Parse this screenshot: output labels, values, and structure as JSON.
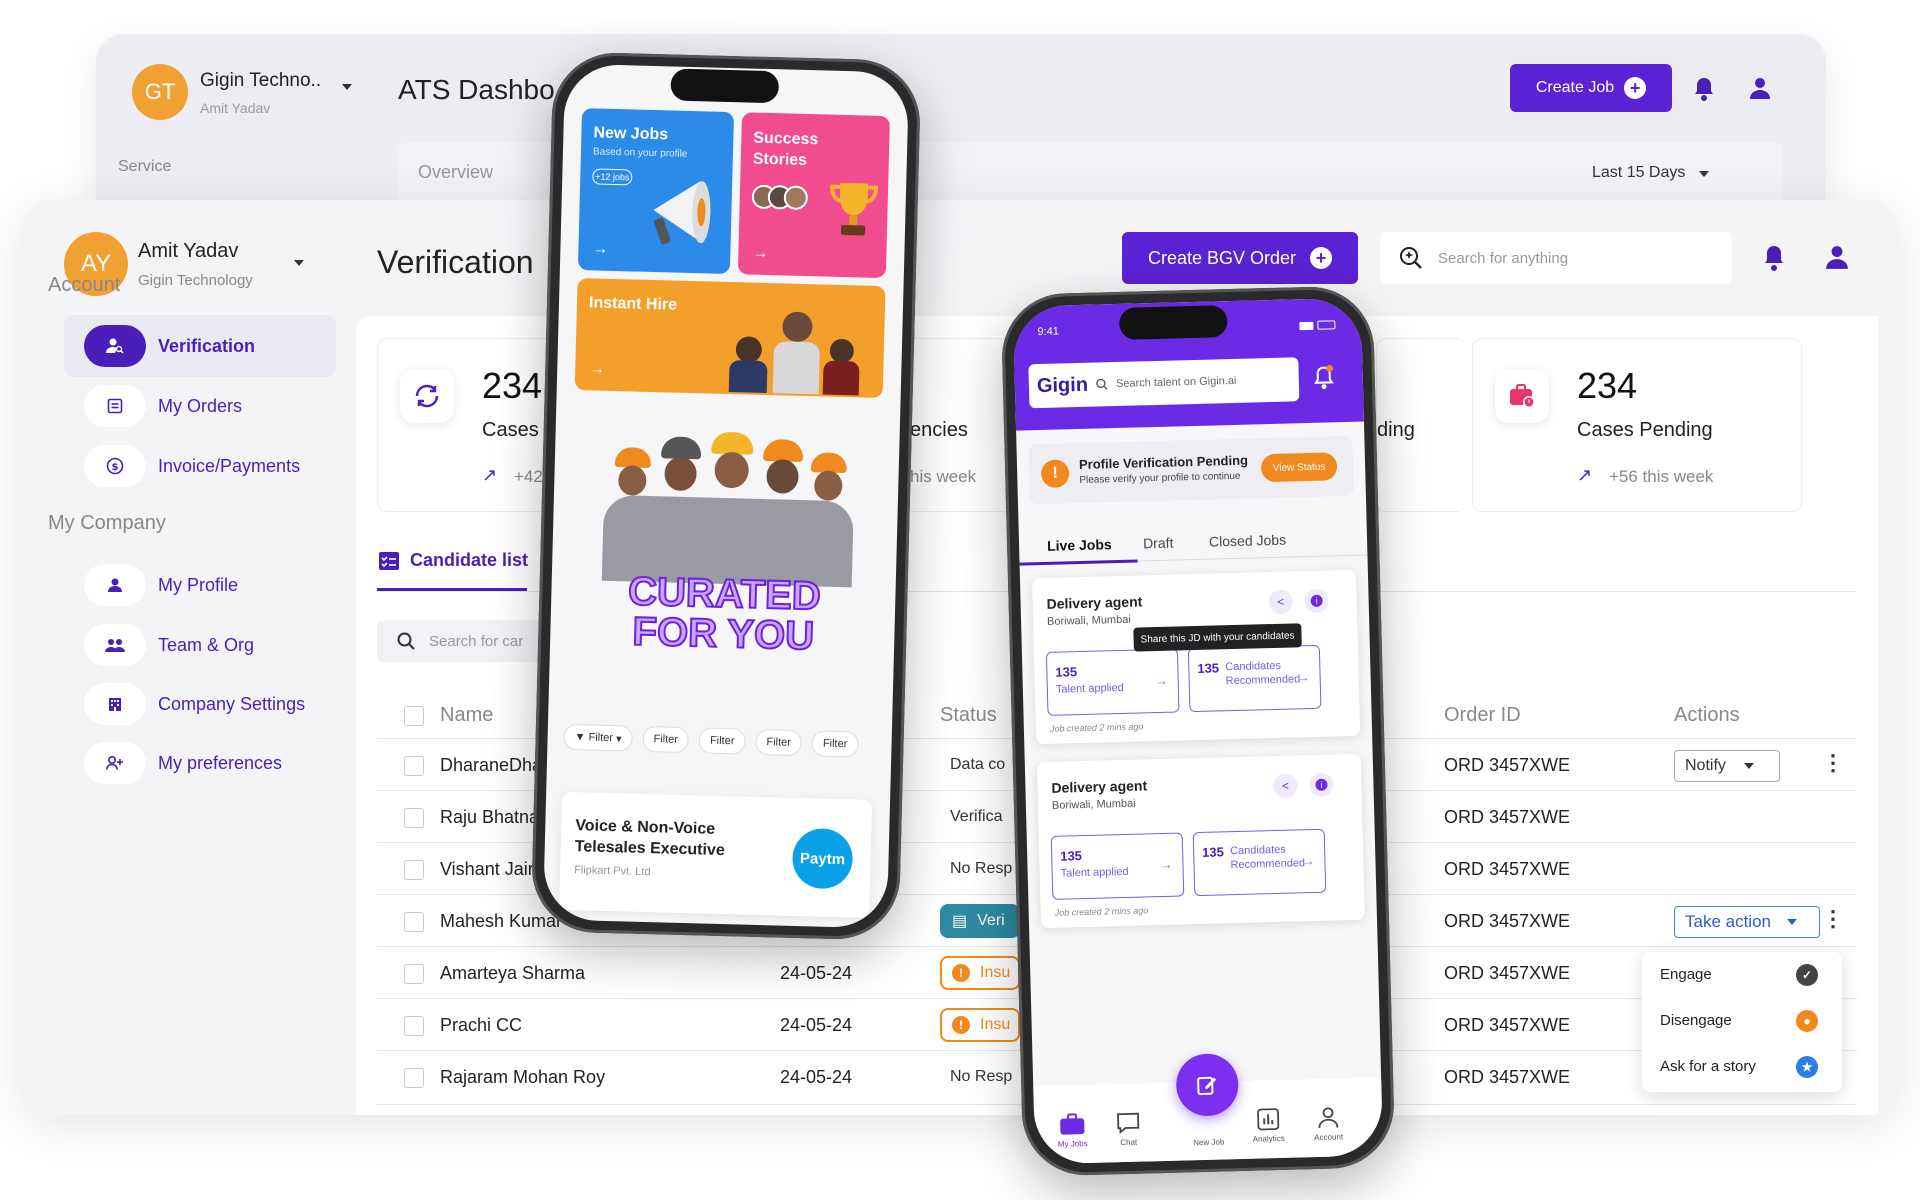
{
  "colors": {
    "primary": "#5a22d4",
    "brand_dark": "#4a1fb8",
    "warning": "#f08a1f",
    "teal": "#2d8aa1",
    "avatar": "#f1a132"
  },
  "back_window": {
    "avatar_initials": "GT",
    "org_name": "Gigin Techno..",
    "user_name": "Amit Yadav",
    "title": "ATS Dashbo",
    "sidebar_label": "Service",
    "tab_overview": "Overview",
    "date_range": "Last 15 Days",
    "create_job": "Create Job"
  },
  "main_window": {
    "avatar_initials": "AY",
    "user_name": "Amit Yadav",
    "org_name": "Gigin Technology",
    "title": "Verification",
    "create_bgv": "Create BGV Order",
    "search_placeholder": "Search for anything",
    "sidebar": {
      "account_heading": "Account",
      "account_items": [
        {
          "label": "Verification",
          "icon": "user-search-icon",
          "active": true
        },
        {
          "label": "My Orders",
          "icon": "orders-icon"
        },
        {
          "label": "Invoice/Payments",
          "icon": "dollar-icon"
        }
      ],
      "company_heading": "My Company",
      "company_items": [
        {
          "label": "My Profile",
          "icon": "person-icon"
        },
        {
          "label": "Team & Org",
          "icon": "team-icon"
        },
        {
          "label": "Company Settings",
          "icon": "building-icon"
        },
        {
          "label": "My preferences",
          "icon": "add-user-icon"
        }
      ]
    },
    "stats": [
      {
        "value": "234",
        "label": "Cases",
        "week": "+42"
      },
      {
        "label": "encies",
        "week": "his week"
      },
      {
        "label": "ding"
      },
      {
        "value": "234",
        "label": "Cases Pending",
        "week": "+56 this week"
      }
    ],
    "candidate_tab": "Candidate list",
    "candidate_search_placeholder": "Search for car",
    "table": {
      "headers": {
        "name": "Name",
        "status": "Status",
        "order_id": "Order ID",
        "actions": "Actions"
      },
      "rows": [
        {
          "name": "DharaneDha",
          "date": "",
          "status": "Data co",
          "order": "ORD 3457XWE"
        },
        {
          "name": "Raju Bhatna",
          "date": "",
          "status": "Verifica",
          "order": "ORD 3457XWE"
        },
        {
          "name": "Vishant Jain",
          "date": "",
          "status": "No Resp",
          "order": "ORD 3457XWE"
        },
        {
          "name": "Mahesh Kumar",
          "date": "",
          "status": "Veri",
          "order": "ORD 3457XWE"
        },
        {
          "name": "Amarteya Sharma",
          "date": "24-05-24",
          "status": "Insu",
          "order": "ORD 3457XWE"
        },
        {
          "name": "Prachi CC",
          "date": "24-05-24",
          "status": "Insu",
          "order": "ORD 3457XWE"
        },
        {
          "name": "Rajaram Mohan Roy",
          "date": "24-05-24",
          "status": "No Resp",
          "order": "ORD 3457XWE"
        }
      ],
      "notify": "Notify",
      "take_action": "Take action",
      "action_menu": [
        "Engage",
        "Disengage",
        "Ask for a story"
      ]
    }
  },
  "phone_left": {
    "new_jobs": {
      "title": "New Jobs",
      "sub": "Based on your profile",
      "badge": "+12 jobs"
    },
    "success": {
      "title": "Success Stories"
    },
    "instant": {
      "title": "Instant Hire"
    },
    "curated": "CURATED FOR YOU",
    "filters": [
      "Filter",
      "Filter",
      "Filter",
      "Filter",
      "Filter"
    ],
    "job": {
      "title": "Voice & Non-Voice Telesales Executive",
      "company": "Flipkart Pvt. Ltd",
      "logo": "Paytm"
    }
  },
  "phone_right": {
    "time": "9:41",
    "brand": "Gigin",
    "search_placeholder": "Search talent on Gigin.ai",
    "pv_title": "Profile Verification Pending",
    "pv_sub": "Please verify your profile to continue",
    "pv_button": "View Status",
    "tabs": [
      "Live Jobs",
      "Draft",
      "Closed Jobs"
    ],
    "tooltip": "Share this JD with your candidates",
    "jobs": [
      {
        "title": "Delivery agent",
        "location": "Boriwali, Mumbai",
        "applied_n": "135",
        "applied_l": "Talent applied",
        "rec_n": "135",
        "rec_l": "Candidates Recommended",
        "meta": "Job created 2 mins ago"
      },
      {
        "title": "Delivery agent",
        "location": "Boriwali, Mumbai",
        "applied_n": "135",
        "applied_l": "Talent applied",
        "rec_n": "135",
        "rec_l": "Candidates Recommended",
        "meta": "Job created 2 mins ago"
      }
    ],
    "nav": [
      "My Jobs",
      "Chat",
      "New Job",
      "Analytics",
      "Account"
    ]
  }
}
